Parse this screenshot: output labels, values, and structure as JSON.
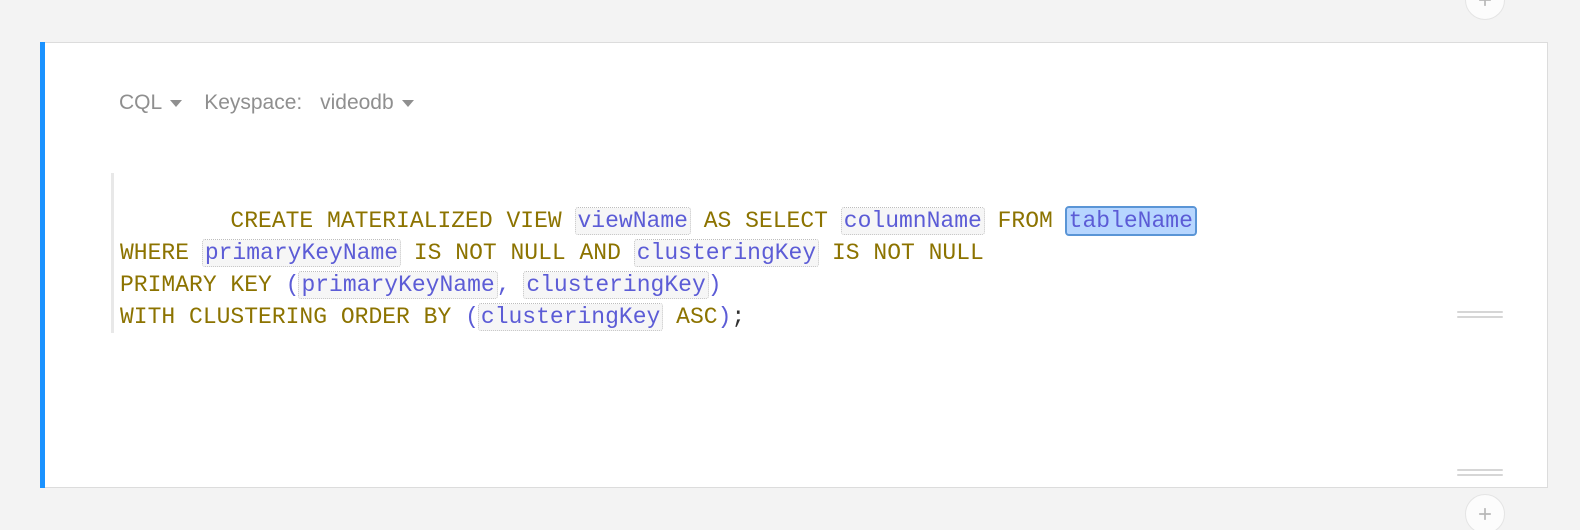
{
  "toolbar": {
    "language_label": "CQL",
    "keyspace_prefix": "Keyspace:",
    "keyspace_value": "videodb"
  },
  "code": {
    "kw_create_matview": "CREATE MATERIALIZED VIEW",
    "ph_viewName": "viewName",
    "kw_as_select": "AS SELECT",
    "ph_columnName": "columnName",
    "kw_from": "FROM",
    "ph_tableName": "tableName",
    "kw_where": "WHERE",
    "ph_primaryKeyName_1": "primaryKeyName",
    "kw_is_not_null_1": "IS NOT NULL AND",
    "ph_clusteringKey_1": "clusteringKey",
    "kw_is_not_null_2": "IS NOT NULL",
    "kw_primary_key": "PRIMARY KEY",
    "paren_open_1": "(",
    "ph_primaryKeyName_2": "primaryKeyName",
    "comma_1": ",",
    "ph_clusteringKey_2": "clusteringKey",
    "paren_close_1": ")",
    "kw_with_cluster": "WITH CLUSTERING ORDER BY",
    "paren_open_2": "(",
    "ph_clusteringKey_3": "clusteringKey",
    "kw_asc": "ASC",
    "paren_close_2": ")",
    "semicolon": ";"
  }
}
